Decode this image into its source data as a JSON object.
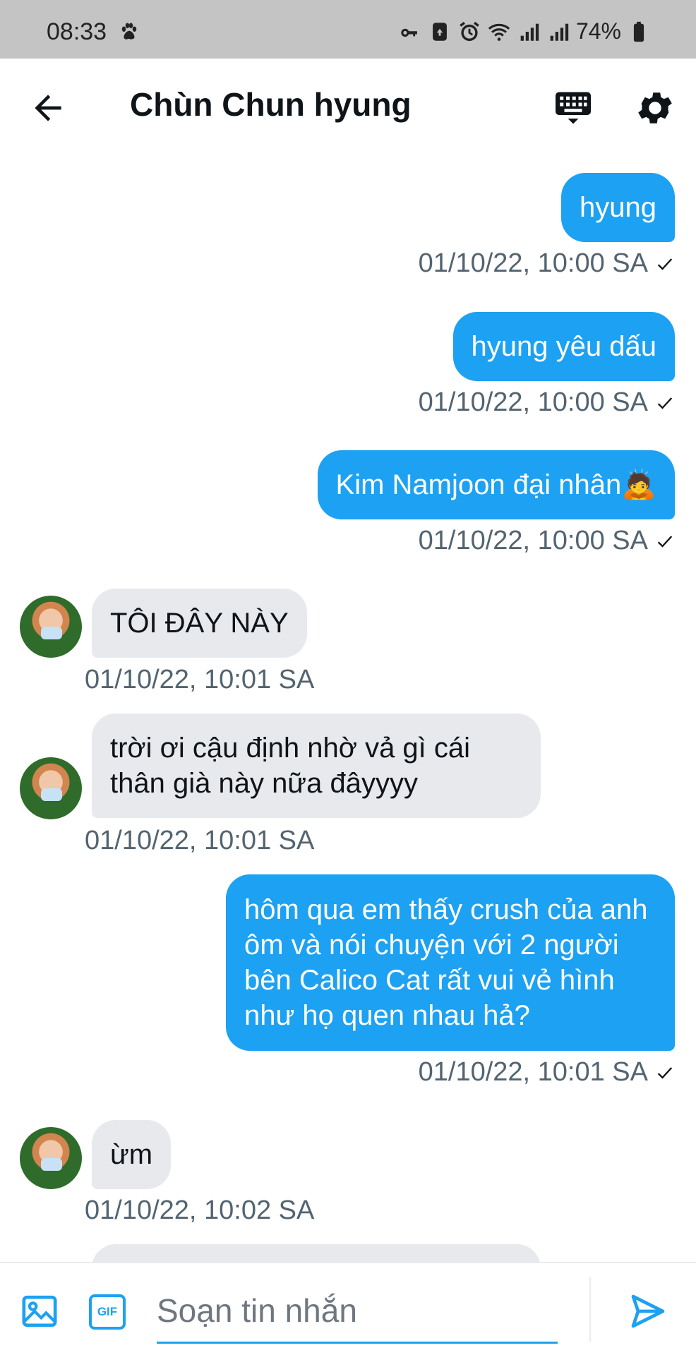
{
  "status_bar": {
    "time": "08:33",
    "battery": "74%",
    "icons": [
      "paw-icon",
      "key-icon",
      "recycle-icon",
      "alarm-icon",
      "wifi-icon",
      "signal-icon",
      "signal-icon",
      "battery-icon"
    ]
  },
  "header": {
    "title": "Chùn Chun hyung",
    "back_icon": "arrow-left-icon",
    "keyboard_icon": "keyboard-icon",
    "settings_icon": "gear-icon"
  },
  "messages": [
    {
      "dir": "out",
      "text": "hyung",
      "time": "01/10/22, 10:00 SA"
    },
    {
      "dir": "out",
      "text": "hyung yêu dấu",
      "time": "01/10/22, 10:00 SA"
    },
    {
      "dir": "out",
      "text": "Kim Namjoon đại nhân🙇",
      "time": "01/10/22, 10:00 SA"
    },
    {
      "dir": "in",
      "text": "TÔI ĐÂY NÀY",
      "time": "01/10/22, 10:01 SA"
    },
    {
      "dir": "in",
      "text": "trời ơi cậu định nhờ vả gì cái thân già này nữa đâyyyy",
      "time": "01/10/22, 10:01 SA"
    },
    {
      "dir": "out",
      "text": "hôm qua em thấy crush của anh ôm và nói chuyện với 2 người bên Calico Cat rất vui vẻ hình như họ quen nhau hả?",
      "time": "01/10/22, 10:01 SA"
    },
    {
      "dir": "in",
      "text": "ừm",
      "time": "01/10/22, 10:02 SA"
    }
  ],
  "composer": {
    "placeholder": "Soạn tin nhắn",
    "gif_label": "GIF",
    "media_icon": "image-icon",
    "send_icon": "send-icon"
  },
  "colors": {
    "accent": "#1da1f2",
    "incoming_bubble": "#e7e9ed",
    "timestamp": "#536471",
    "status_bar": "#c4c4c4"
  }
}
